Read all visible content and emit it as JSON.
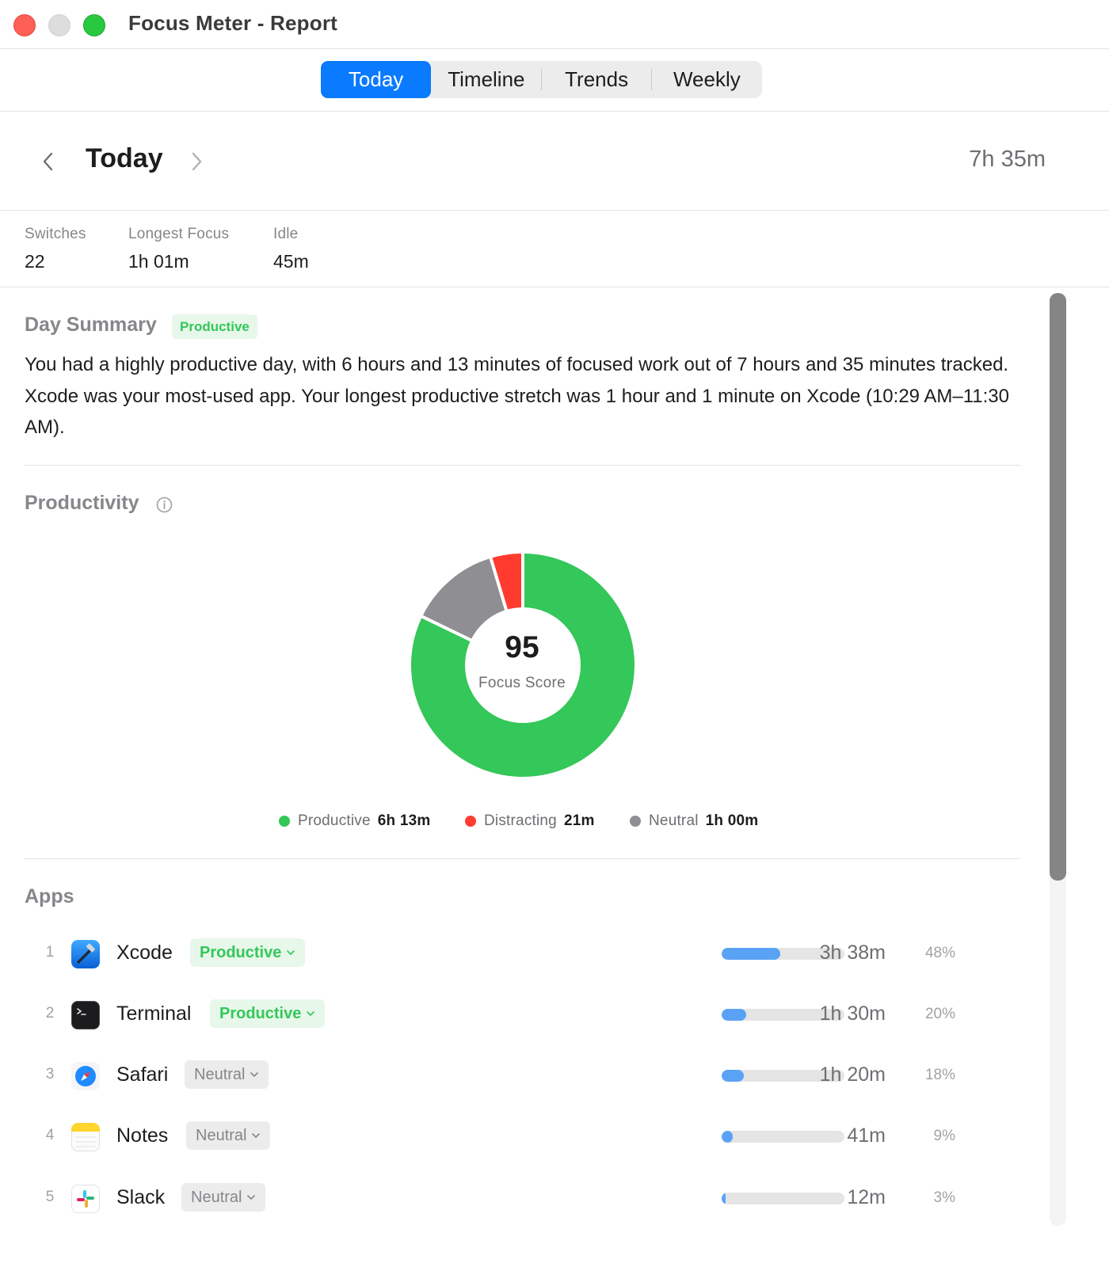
{
  "window": {
    "title": "Focus Meter - Report"
  },
  "tabs": [
    {
      "label": "Today",
      "active": true
    },
    {
      "label": "Timeline",
      "active": false
    },
    {
      "label": "Trends",
      "active": false
    },
    {
      "label": "Weekly",
      "active": false
    }
  ],
  "header": {
    "title": "Today",
    "total_time": "7h 35m"
  },
  "stats": [
    {
      "label": "Switches",
      "value": "22"
    },
    {
      "label": "Longest Focus",
      "value": "1h 01m"
    },
    {
      "label": "Idle",
      "value": "45m"
    }
  ],
  "summary": {
    "title": "Day Summary",
    "badge": "Productive",
    "text": "You had a highly productive day, with 6 hours and 13 minutes of focused work out of 7 hours and 35 minutes tracked. Xcode was your most-used app. Your longest productive stretch was 1 hour and 1 minute on Xcode (10:29 AM–11:30 AM)."
  },
  "productivity": {
    "title": "Productivity",
    "score": "95",
    "score_label": "Focus Score",
    "legend": [
      {
        "name": "Productive",
        "value": "6h 13m",
        "color": "#34c759"
      },
      {
        "name": "Distracting",
        "value": "21m",
        "color": "#ff3b30"
      },
      {
        "name": "Neutral",
        "value": "1h 00m",
        "color": "#8e8e93"
      }
    ]
  },
  "chart_data": {
    "type": "pie",
    "categories": [
      "Productive",
      "Neutral",
      "Distracting"
    ],
    "values": [
      373,
      60,
      21
    ],
    "colors": [
      "#34c759",
      "#8e8e93",
      "#ff3b30"
    ]
  },
  "apps": {
    "title": "Apps",
    "items": [
      {
        "rank": "1",
        "name": "Xcode",
        "category": "Productive",
        "kind": "productive",
        "time": "3h 38m",
        "percent": "48%",
        "share": 0.48,
        "icon": "xcode-icon"
      },
      {
        "rank": "2",
        "name": "Terminal",
        "category": "Productive",
        "kind": "productive",
        "time": "1h 30m",
        "percent": "20%",
        "share": 0.2,
        "icon": "terminal-icon"
      },
      {
        "rank": "3",
        "name": "Safari",
        "category": "Neutral",
        "kind": "neutral",
        "time": "1h 20m",
        "percent": "18%",
        "share": 0.18,
        "icon": "safari-icon"
      },
      {
        "rank": "4",
        "name": "Notes",
        "category": "Neutral",
        "kind": "neutral",
        "time": "41m",
        "percent": "9%",
        "share": 0.09,
        "icon": "notes-icon"
      },
      {
        "rank": "5",
        "name": "Slack",
        "category": "Neutral",
        "kind": "neutral",
        "time": "12m",
        "percent": "3%",
        "share": 0.03,
        "icon": "slack-icon"
      }
    ]
  }
}
